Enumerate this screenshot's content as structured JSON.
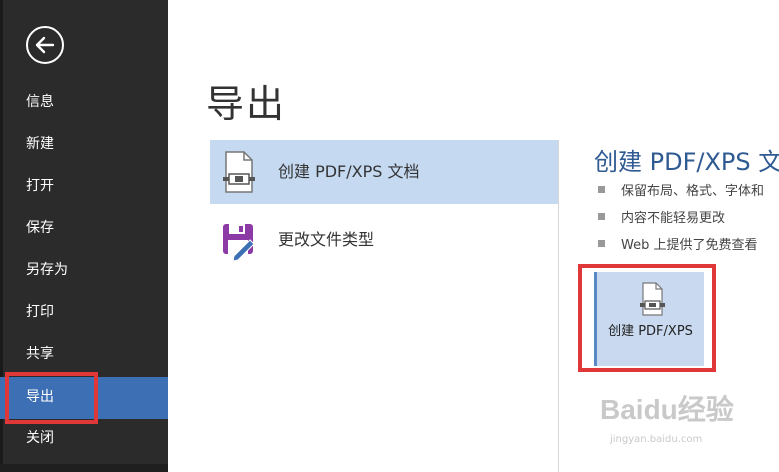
{
  "sidebar": {
    "items": [
      {
        "label": "信息"
      },
      {
        "label": "新建"
      },
      {
        "label": "打开"
      },
      {
        "label": "保存"
      },
      {
        "label": "另存为"
      },
      {
        "label": "打印"
      },
      {
        "label": "共享"
      },
      {
        "label": "导出",
        "active": true
      },
      {
        "label": "关闭"
      }
    ]
  },
  "main": {
    "title": "导出",
    "options": [
      {
        "label": "创建 PDF/XPS 文档",
        "icon": "pdf-document-icon",
        "selected": true
      },
      {
        "label": "更改文件类型",
        "icon": "change-file-type-icon",
        "selected": false
      }
    ]
  },
  "panel": {
    "title": "创建 PDF/XPS 文",
    "bullets": [
      "保留布局、格式、字体和",
      "内容不能轻易更改",
      "Web 上提供了免费查看"
    ],
    "create_button_label": "创建 PDF/XPS"
  },
  "watermark": {
    "text": "Baidu经验",
    "url": "jingyan.baidu.com"
  },
  "colors": {
    "sidebar_bg": "#2b2b2b",
    "active_nav": "#3c6fb3",
    "selected_option": "#c5d9f1",
    "title_blue": "#2f5a92",
    "highlight_red": "#e03838"
  }
}
